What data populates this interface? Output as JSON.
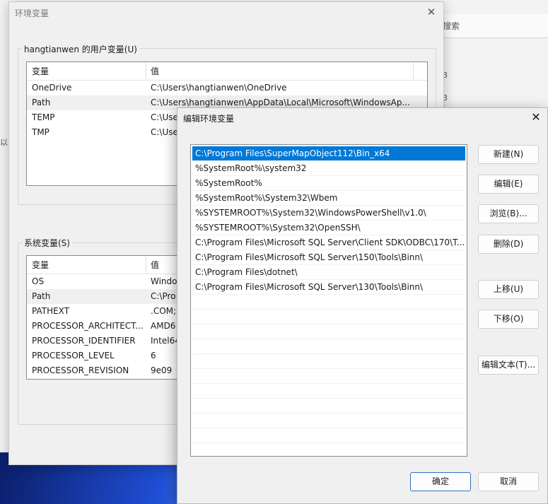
{
  "background": {
    "search_text": "搜索",
    "fragments": [
      "3",
      "3",
      "以"
    ]
  },
  "env_dialog": {
    "title": "环境变量",
    "user_group_label": "hangtianwen 的用户变量(U)",
    "user_columns": [
      "变量",
      "值"
    ],
    "user_rows": [
      {
        "name": "OneDrive",
        "value": "C:\\Users\\hangtianwen\\OneDrive"
      },
      {
        "name": "Path",
        "value": "C:\\Users\\hangtianwen\\AppData\\Local\\Microsoft\\WindowsAp..."
      },
      {
        "name": "TEMP",
        "value": "C:\\Use"
      },
      {
        "name": "TMP",
        "value": "C:\\Use"
      }
    ],
    "system_group_label": "系统变量(S)",
    "system_columns": [
      "变量",
      "值"
    ],
    "system_rows": [
      {
        "name": "OS",
        "value": "Windo"
      },
      {
        "name": "Path",
        "value": "C:\\Pro"
      },
      {
        "name": "PATHEXT",
        "value": ".COM;"
      },
      {
        "name": "PROCESSOR_ARCHITECT...",
        "value": "AMD6"
      },
      {
        "name": "PROCESSOR_IDENTIFIER",
        "value": "Intel64"
      },
      {
        "name": "PROCESSOR_LEVEL",
        "value": "6"
      },
      {
        "name": "PROCESSOR_REVISION",
        "value": "9e09"
      }
    ]
  },
  "edit_dialog": {
    "title": "编辑环境变量",
    "entries": [
      "C:\\Program Files\\SuperMapObject112\\Bin_x64",
      "%SystemRoot%\\system32",
      "%SystemRoot%",
      "%SystemRoot%\\System32\\Wbem",
      "%SYSTEMROOT%\\System32\\WindowsPowerShell\\v1.0\\",
      "%SYSTEMROOT%\\System32\\OpenSSH\\",
      "C:\\Program Files\\Microsoft SQL Server\\Client SDK\\ODBC\\170\\T...",
      "C:\\Program Files\\Microsoft SQL Server\\150\\Tools\\Binn\\",
      "C:\\Program Files\\dotnet\\",
      "C:\\Program Files\\Microsoft SQL Server\\130\\Tools\\Binn\\"
    ],
    "selected_index": 0,
    "buttons": {
      "new": "新建(N)",
      "edit": "编辑(E)",
      "browse": "浏览(B)...",
      "delete": "删除(D)",
      "move_up": "上移(U)",
      "move_down": "下移(O)",
      "edit_text": "编辑文本(T)...",
      "ok": "确定",
      "cancel": "取消"
    }
  }
}
